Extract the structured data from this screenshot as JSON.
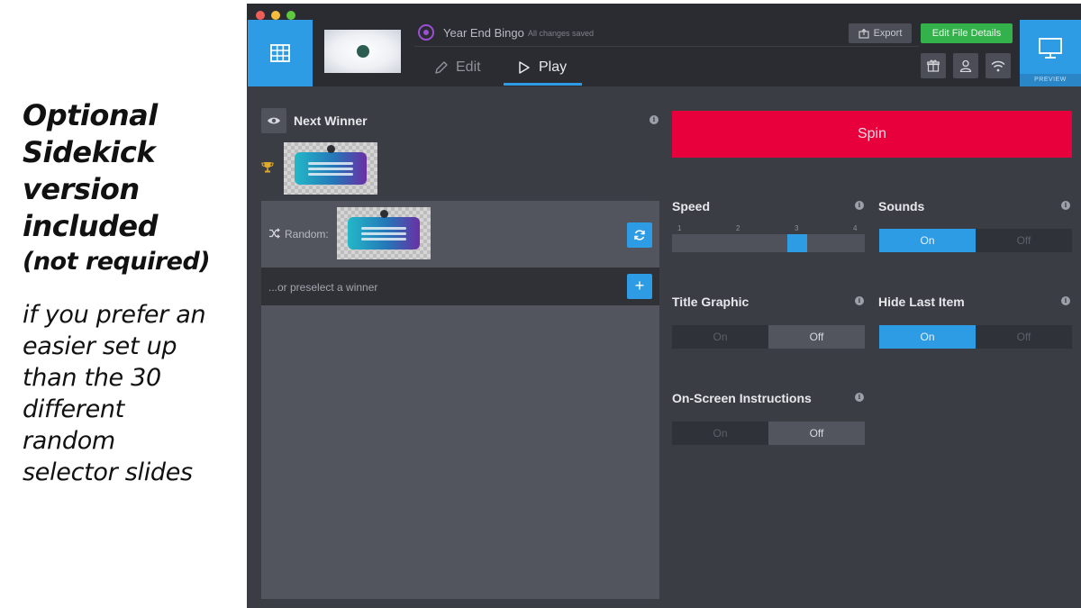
{
  "caption": {
    "heading_lines": [
      "Optional",
      "Sidekick",
      "version",
      "included"
    ],
    "heading_sub": "(not required)",
    "body_lines": [
      "if you prefer an",
      "easier set up",
      "than the 30",
      "different",
      "random",
      "selector slides"
    ]
  },
  "app": {
    "file_title": "Year End Bingo",
    "saved_status": "All changes saved",
    "tabs": {
      "edit": "Edit",
      "play": "Play"
    },
    "active_tab": "Play",
    "export_label": "Export",
    "edit_details_label": "Edit File Details",
    "preview_label": "PREVIEW"
  },
  "left_panel": {
    "next_winner_label": "Next Winner",
    "random_label": "Random:",
    "preselect_placeholder": "...or preselect a winner",
    "add_label": "+"
  },
  "right_panel": {
    "spin_label": "Spin",
    "speed": {
      "label": "Speed",
      "ticks": [
        "1",
        "2",
        "3",
        "4"
      ],
      "value": 3
    },
    "sounds": {
      "label": "Sounds",
      "on": "On",
      "off": "Off",
      "value": "On"
    },
    "title_graphic": {
      "label": "Title Graphic",
      "on": "On",
      "off": "Off",
      "value": "Off"
    },
    "hide_last_item": {
      "label": "Hide Last Item",
      "on": "On",
      "off": "Off",
      "value": "On"
    },
    "onscreen_instructions": {
      "label": "On-Screen Instructions",
      "on": "On",
      "off": "Off",
      "value": "Off"
    }
  },
  "colors": {
    "accent_blue": "#2d9ce5",
    "spin_red": "#e8003d",
    "edit_details_green": "#33b24c",
    "app_background": "#3b3d45"
  },
  "icons": [
    "grid-icon",
    "pencil-icon",
    "play-icon",
    "export-icon",
    "gift-icon",
    "user-icon",
    "wifi-icon",
    "monitor-icon",
    "eye-icon",
    "info-icon",
    "trophy-icon",
    "shuffle-icon",
    "refresh-icon"
  ]
}
